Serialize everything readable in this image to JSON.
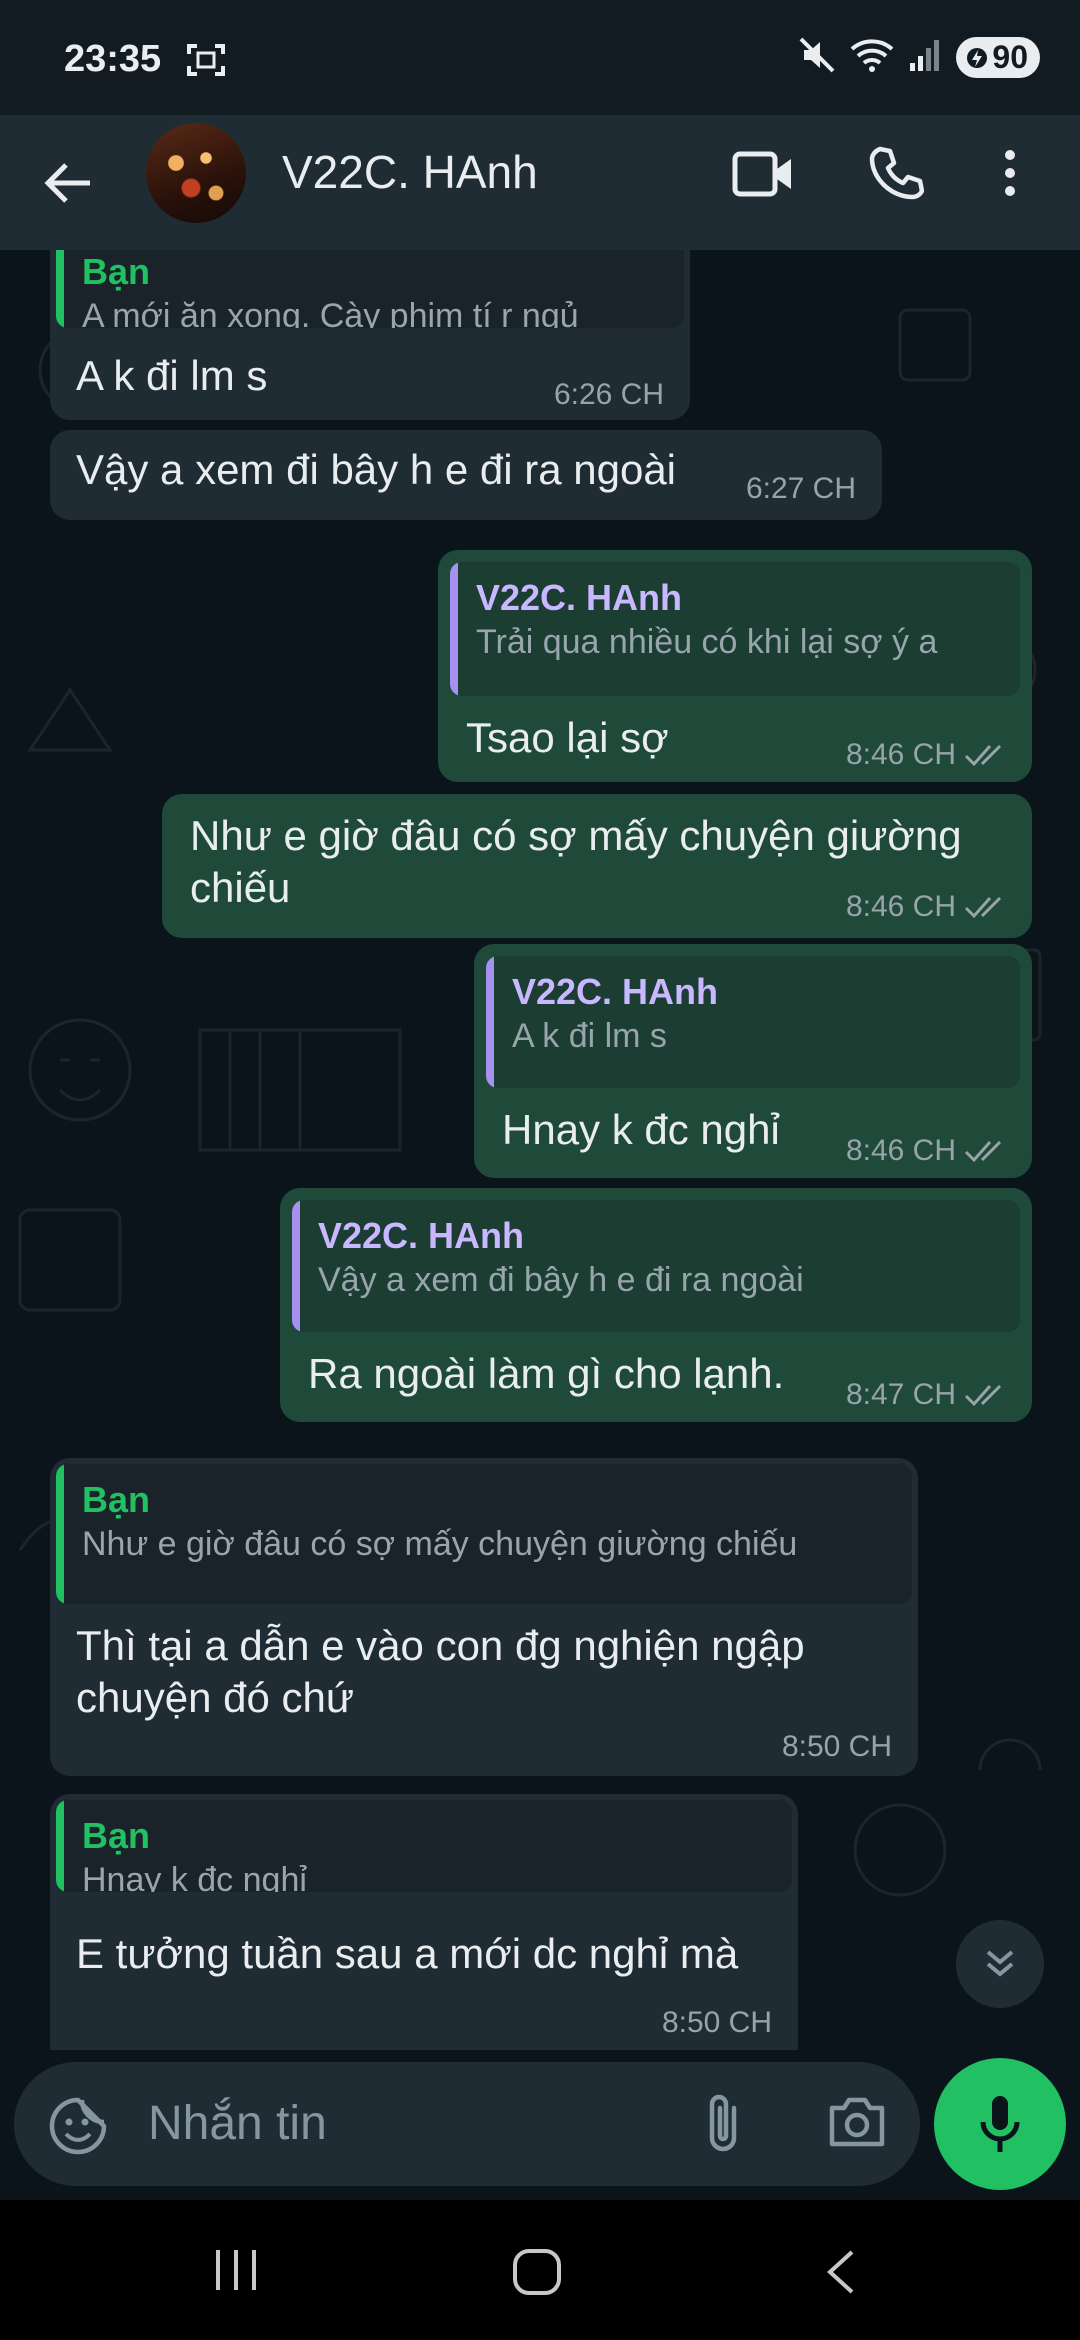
{
  "status_bar": {
    "time": "23:35",
    "battery": "90"
  },
  "app_bar": {
    "contact_name": "V22C. HAnh"
  },
  "messages": [
    {
      "quote_name": "Bạn",
      "quote_text": "A mới ăn xong. Cày phim tí r ngủ",
      "text": "A k đi lm s",
      "time": "6:26 CH"
    },
    {
      "text": "Vậy a xem đi bây h e đi ra ngoài",
      "time": "6:27 CH"
    },
    {
      "quote_name": "V22C. HAnh",
      "quote_text": "Trải qua nhiều có khi lại sợ ý a",
      "text": "Tsao lại sợ",
      "time": "8:46 CH"
    },
    {
      "text": "Như e giờ đâu có sợ mấy chuyện giường chiếu",
      "time": "8:46 CH"
    },
    {
      "quote_name": "V22C. HAnh",
      "quote_text": "A k đi lm s",
      "text": "Hnay  k đc nghỉ",
      "time": "8:46 CH"
    },
    {
      "quote_name": "V22C. HAnh",
      "quote_text": "Vậy a xem đi bây h e đi ra ngoài",
      "text": "Ra ngoài làm gì cho lạnh.",
      "time": "8:47 CH"
    },
    {
      "quote_name": "Bạn",
      "quote_text": "Như e giờ đâu có sợ mấy chuyện giường chiếu",
      "text": "Thì tại a dẫn e vào con đg nghiện ngập chuyện đó chứ",
      "time": "8:50 CH"
    },
    {
      "quote_name": "Bạn",
      "quote_text": "Hnay  k đc nghỉ",
      "text": "E tưởng tuần sau a mới dc nghỉ mà",
      "time": "8:50 CH"
    }
  ],
  "input": {
    "placeholder": "Nhắn tin"
  },
  "colors": {
    "accent_green": "#21c063",
    "quote_you": "#21c063",
    "quote_contact": "#a791f0",
    "received_bubble": "#202c33",
    "sent_bubble": "#1f4a3a"
  }
}
